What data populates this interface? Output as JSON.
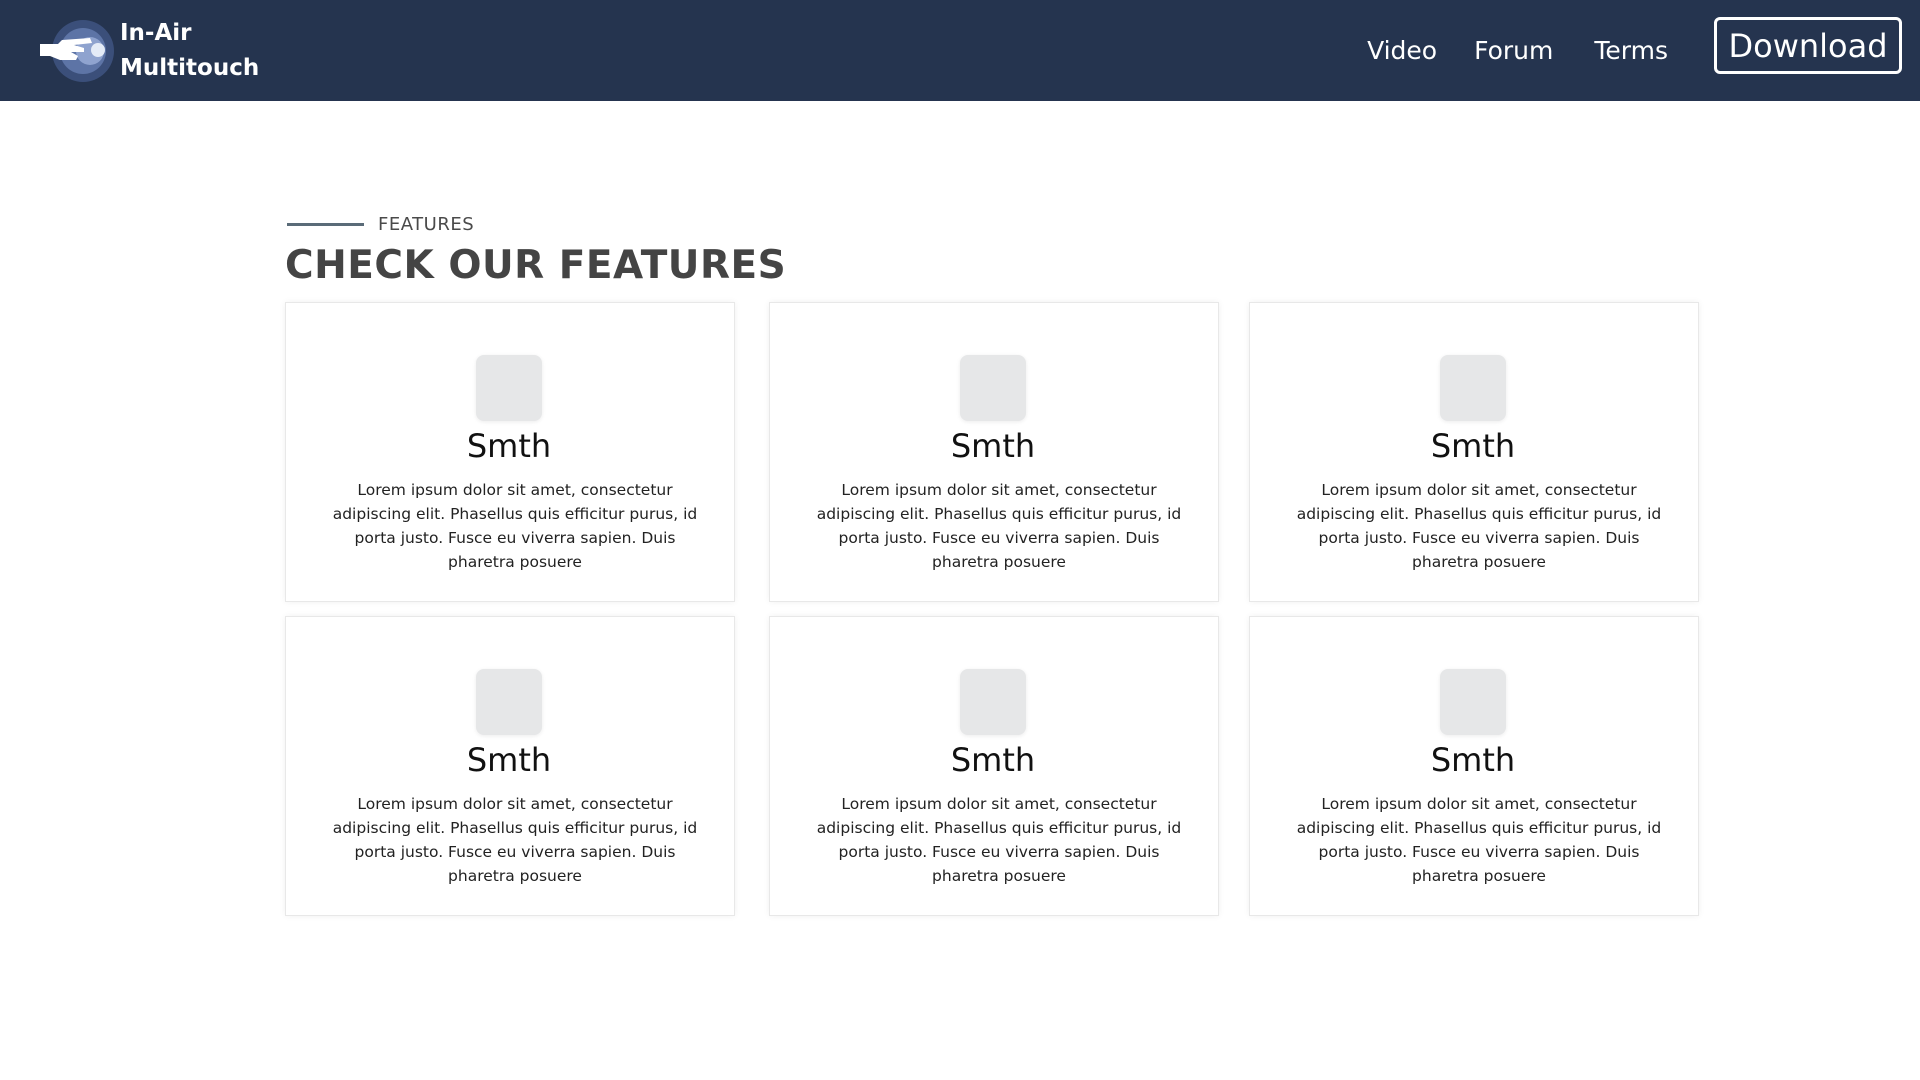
{
  "header": {
    "brand_line1": "In-Air",
    "brand_line2": "Multitouch",
    "logo_icon": "hand-gesture-logo",
    "nav": [
      {
        "label": "Video"
      },
      {
        "label": "Forum"
      },
      {
        "label": "Terms"
      }
    ],
    "download_label": "Download",
    "background_color": "#25344f"
  },
  "section": {
    "eyebrow": "FEATURES",
    "title": "CHECK OUR FEATURES"
  },
  "features": [
    {
      "title": "Smth",
      "text": "Lorem ipsum dolor sit amet, consectetur adipiscing elit. Phasellus quis efficitur purus, id porta justo. Fusce eu viverra sapien. Duis pharetra posuere",
      "icon": "placeholder-icon"
    },
    {
      "title": "Smth",
      "text": "Lorem ipsum dolor sit amet, consectetur adipiscing elit. Phasellus quis efficitur purus, id porta justo. Fusce eu viverra sapien. Duis pharetra posuere",
      "icon": "placeholder-icon"
    },
    {
      "title": "Smth",
      "text": "Lorem ipsum dolor sit amet, consectetur adipiscing elit. Phasellus quis efficitur purus, id porta justo. Fusce eu viverra sapien. Duis pharetra posuere",
      "icon": "placeholder-icon"
    },
    {
      "title": "Smth",
      "text": "Lorem ipsum dolor sit amet, consectetur adipiscing elit. Phasellus quis efficitur purus, id porta justo. Fusce eu viverra sapien. Duis pharetra posuere",
      "icon": "placeholder-icon"
    },
    {
      "title": "Smth",
      "text": "Lorem ipsum dolor sit amet, consectetur adipiscing elit. Phasellus quis efficitur purus, id porta justo. Fusce eu viverra sapien. Duis pharetra posuere",
      "icon": "placeholder-icon"
    },
    {
      "title": "Smth",
      "text": "Lorem ipsum dolor sit amet, consectetur adipiscing elit. Phasellus quis efficitur purus, id porta justo. Fusce eu viverra sapien. Duis pharetra posuere",
      "icon": "placeholder-icon"
    }
  ]
}
